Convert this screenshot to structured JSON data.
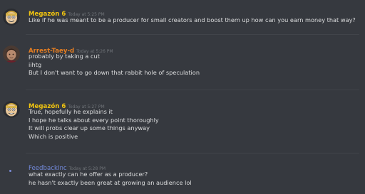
{
  "messages": [
    {
      "username": "Megazón 6",
      "username_color": "#f1c40f",
      "timestamp": "Today at 5:25 PM",
      "avatar": "cartoon-face-avatar",
      "lines": [
        "Like if he was meant to be a producer for small creators and boost them up how can you earn money that way?"
      ]
    },
    {
      "username": "Arrest-Taey-d",
      "username_color": "#e67e22",
      "timestamp": "Today at 5:26 PM",
      "avatar": "portrait-avatar",
      "lines": [
        "probably by taking a cut",
        "iihtg",
        "But I don't want to go down that rabbit hole of speculation"
      ]
    },
    {
      "username": "Megazón 6",
      "username_color": "#f1c40f",
      "timestamp": "Today at 5:27 PM",
      "avatar": "cartoon-face-avatar",
      "lines": [
        "True, hopefully he explains it",
        "I hope he talks about every point thoroughly",
        "It will probs clear up some things anyway",
        "Which is positive"
      ]
    },
    {
      "username": "FeedbackInc",
      "username_color": "#7289da",
      "timestamp": "Today at 5:28 PM",
      "avatar": "dot-avatar",
      "lines": [
        "what exactly can he offer as a producer?",
        "he hasn't exactly been great at growing an audience lol"
      ]
    }
  ]
}
